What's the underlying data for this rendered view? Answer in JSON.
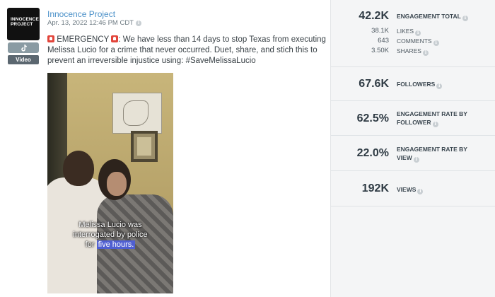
{
  "post": {
    "avatar_text": "INNOCENCE PROJECT",
    "platform_icon": "tiktok-icon",
    "media_type": "Video",
    "account_name": "Innocence Project",
    "date": "Apr. 13, 2022 12:46 PM CDT",
    "caption_before": " EMERGENCY ",
    "caption_after": ": We have less than 14 days to stop Texas from executing Melissa Lucio for a crime that never occurred. Duet, share, and stich this to prevent an irreversible injustice using: #SaveMelissaLucio",
    "video_overlay_line1": "Melissa Lucio was",
    "video_overlay_line2": "interrogated by police",
    "video_overlay_line3_prefix": "for ",
    "video_overlay_line3_highlight": "five hours."
  },
  "metrics": {
    "engagement_total": {
      "value": "42.2K",
      "label": "ENGAGEMENT TOTAL"
    },
    "likes": {
      "value": "38.1K",
      "label": "LIKES"
    },
    "comments": {
      "value": "643",
      "label": "COMMENTS"
    },
    "shares": {
      "value": "3.50K",
      "label": "SHARES"
    },
    "followers": {
      "value": "67.6K",
      "label": "FOLLOWERS"
    },
    "engagement_rate_follower": {
      "value": "62.5%",
      "label_line1": "ENGAGEMENT RATE BY",
      "label_line2": "FOLLOWER"
    },
    "engagement_rate_view": {
      "value": "22.0%",
      "label_line1": "ENGAGEMENT RATE BY",
      "label_line2": "VIEW"
    },
    "views": {
      "value": "192K",
      "label": "VIEWS"
    }
  },
  "colors": {
    "account_link": "#4a90c8",
    "metrics_bg": "#f4f5f6",
    "overlay_highlight": "#4f5fd1",
    "siren": "#e2453b"
  }
}
